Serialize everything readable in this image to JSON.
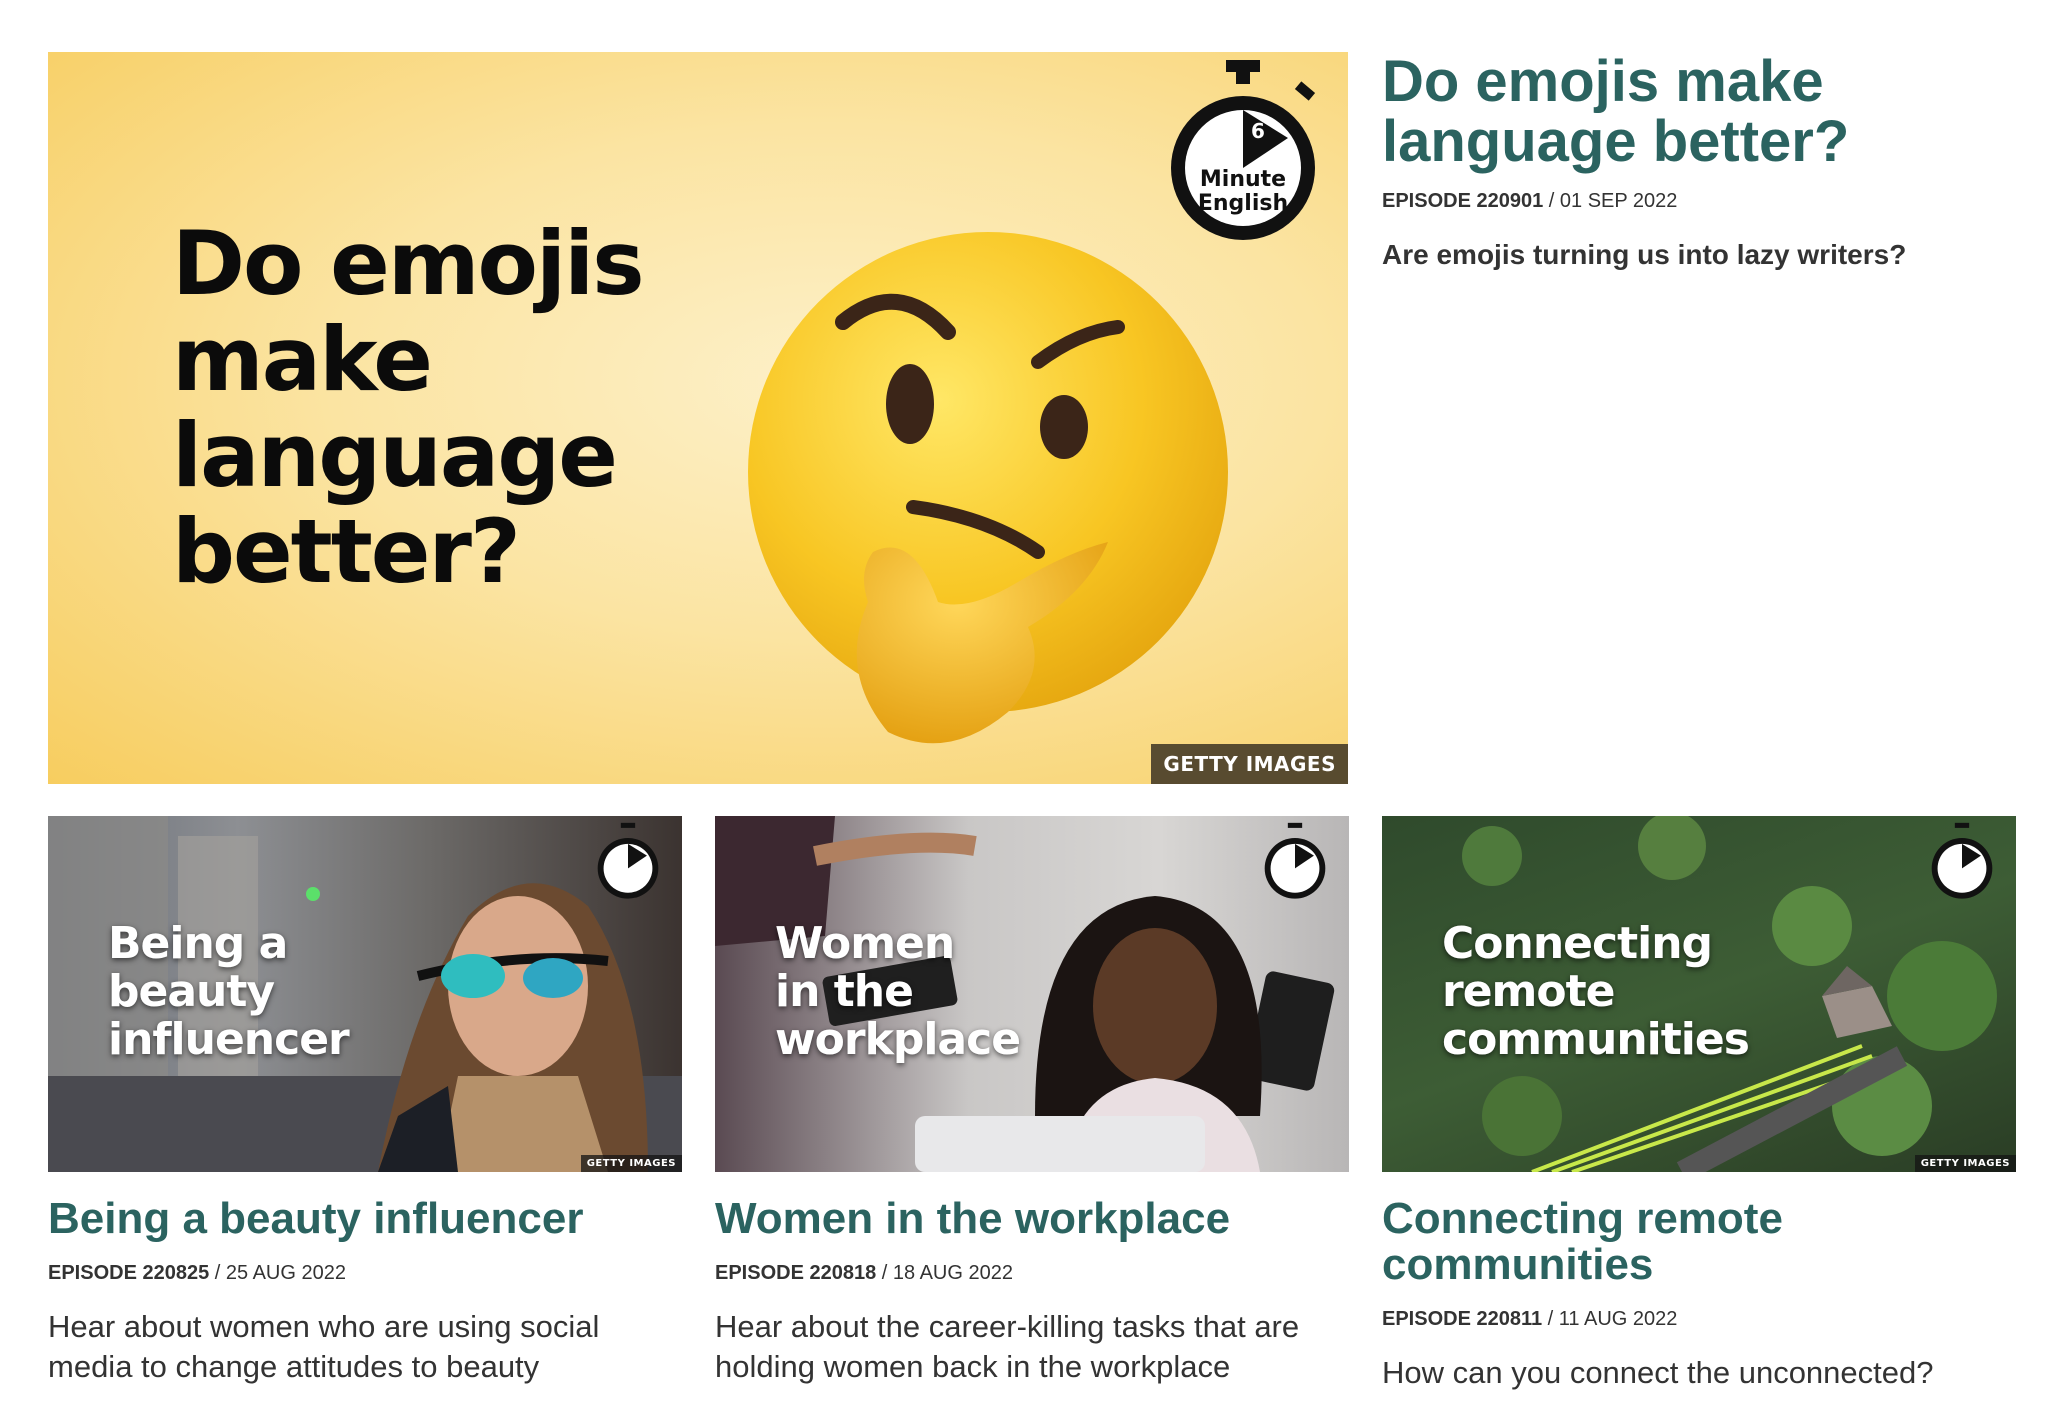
{
  "feature": {
    "image_headline": [
      "Do emojis",
      "make",
      "language",
      "better?"
    ],
    "image_credit": "GETTY IMAGES",
    "badge_number": "6",
    "badge_line1": "Minute",
    "badge_line2": "English",
    "title": "Do emojis make language better?",
    "episode_label": "EPISODE 220901",
    "date": "/ 01 SEP 2022",
    "description": "Are emojis turning us into lazy writers?"
  },
  "cards": [
    {
      "overlay_title": [
        "Being a",
        "beauty",
        "influencer"
      ],
      "credit": "GETTY IMAGES",
      "title": "Being a beauty influencer",
      "episode_label": "EPISODE 220825",
      "date": "/ 25 AUG 2022",
      "description": "Hear about women who are using social media to change attitudes to beauty"
    },
    {
      "overlay_title": [
        "Women",
        "in the",
        "workplace"
      ],
      "credit": "",
      "title": "Women in the workplace",
      "episode_label": "EPISODE 220818",
      "date": "/ 18 AUG 2022",
      "description": "Hear about the career-killing tasks that are holding women back in the workplace"
    },
    {
      "overlay_title": [
        "Connecting",
        "remote",
        "communities"
      ],
      "credit": "GETTY IMAGES",
      "title": "Connecting remote communities",
      "episode_label": "EPISODE 220811",
      "date": "/ 11 AUG 2022",
      "description": "How can you connect the unconnected?"
    }
  ],
  "colors": {
    "title_teal": "#2b6360",
    "feature_bg": "#f7cd5f"
  }
}
